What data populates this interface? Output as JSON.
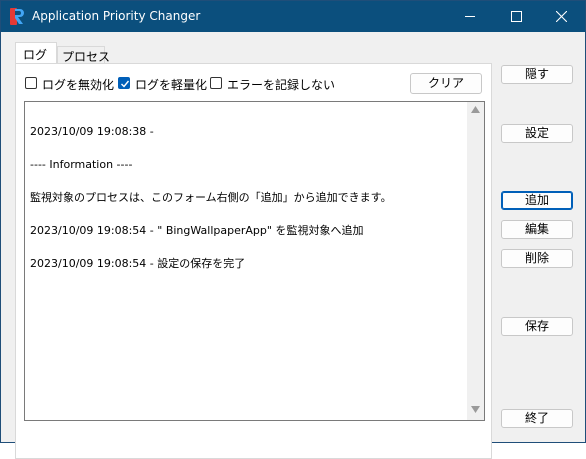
{
  "window": {
    "title": "Application Priority Changer",
    "icon": "app-icon",
    "controls": [
      "minimize-icon",
      "maximize-icon",
      "close-icon"
    ]
  },
  "tabs": [
    {
      "label": "ログ",
      "selected": true
    },
    {
      "label": "プロセス",
      "selected": false
    }
  ],
  "options": {
    "disable_log": {
      "label": "ログを無効化",
      "checked": false
    },
    "lighten_log": {
      "label": "ログを軽量化",
      "checked": true
    },
    "no_error_log": {
      "label": "エラーを記録しない",
      "checked": false
    },
    "clear_label": "クリア"
  },
  "log": {
    "lines": [
      "2023/10/09 19:08:38 -",
      "---- Information ----",
      "監視対象のプロセスは、このフォーム右側の「追加」から追加できます。",
      "2023/10/09 19:08:54 - \" BingWallpaperApp\" を監視対象へ追加",
      "2023/10/09 19:08:54 - 設定の保存を完了"
    ]
  },
  "side_buttons": {
    "hide": "隠す",
    "settings": "設定",
    "add": "追加",
    "edit": "編集",
    "delete": "削除",
    "save": "保存",
    "exit": "終了"
  },
  "colors": {
    "titlebar": "#0b4f7d",
    "accent": "#005fb8",
    "window_bg": "#f0f0f0"
  }
}
